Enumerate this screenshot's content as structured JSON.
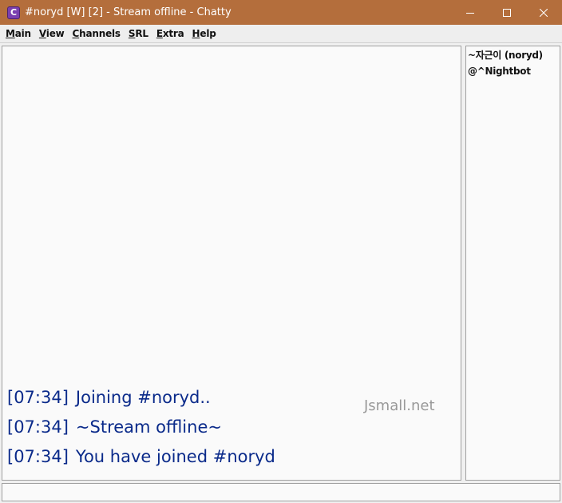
{
  "window": {
    "title": "#noryd [W] [2] - Stream offline - Chatty",
    "app_icon_letter": "C",
    "controls": {
      "minimize": "—",
      "maximize": "☐",
      "close": "✕"
    }
  },
  "menu": {
    "items": [
      {
        "mnemonic": "M",
        "rest": "ain"
      },
      {
        "mnemonic": "V",
        "rest": "iew"
      },
      {
        "mnemonic": "C",
        "rest": "hannels"
      },
      {
        "mnemonic": "S",
        "rest": "RL"
      },
      {
        "mnemonic": "E",
        "rest": "xtra"
      },
      {
        "mnemonic": "H",
        "rest": "elp"
      }
    ]
  },
  "chat": {
    "messages": [
      {
        "time": "[07:34]",
        "text": "Joining #noryd.."
      },
      {
        "time": "[07:34]",
        "text": "~Stream offline~"
      },
      {
        "time": "[07:34]",
        "text": "You have joined #noryd"
      }
    ],
    "watermark": "Jsmall.net"
  },
  "userlist": {
    "users": [
      "~자근이 (noryd)",
      "@^Nightbot"
    ]
  },
  "input": {
    "value": ""
  }
}
